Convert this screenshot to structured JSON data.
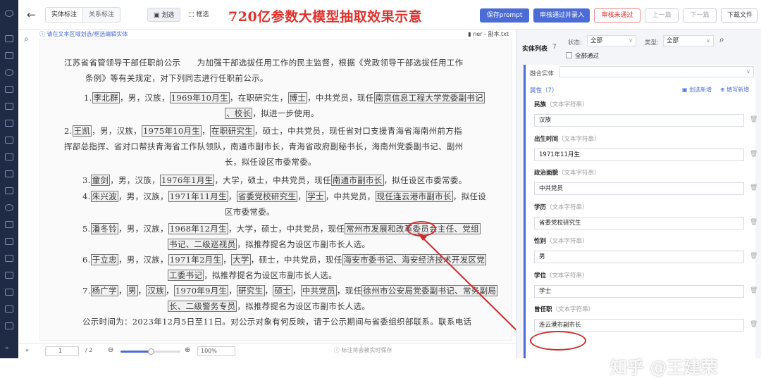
{
  "topbar": {
    "seg_entity": "实体标注",
    "seg_relation": "关系标注",
    "tool_mark": "划选",
    "tool_box": "框选",
    "headline": "720亿参数大模型抽取效果示意",
    "save_prompt": "保存prompt",
    "approve": "审核通过并录入",
    "reject": "审核未通过",
    "prev": "上一篇",
    "next": "下一篇",
    "download": "下载文件"
  },
  "doc": {
    "hint": "请在文本区域划选/框选编辑实体",
    "filename": "ner - 副本.txt",
    "lines": [
      [
        "江苏省省管领导干部任职前公示　　为加强干部选拔任用工作的民主监督，根据《党政领导干部选拔任用工作"
      ],
      [
        "条例》等有关规定，对下列同志进行任职前公示。"
      ],
      [
        "1.",
        {
          "b": "李北群"
        },
        "，男，汉族，",
        {
          "b": "1969年10月生"
        },
        "，在职研究生，",
        {
          "b": "博士"
        },
        "，中共党员，现任",
        {
          "b": "南京信息工程大学党委副书记"
        }
      ],
      [
        {
          "b": "、校长"
        },
        "，拟进一步使用。"
      ],
      [
        "2.",
        {
          "b": "王凯"
        },
        "，男，汉族，",
        {
          "b": "1975年10月生"
        },
        "，",
        {
          "b": "在职研究生"
        },
        "，硕士，中共党员，现任省对口支援青海省海南州前方指"
      ],
      [
        "挥部总指挥、省对口帮扶青海省工作队领队，南通市副市长，青海省政府副秘书长，海南州党委副书记、副州"
      ],
      [
        "长，拟任设区市委常委。"
      ],
      [
        "3.",
        {
          "b": "童剑"
        },
        "，男，汉族，",
        {
          "b": "1976年1月生"
        },
        "，大学，硕士，中共党员，现任",
        {
          "b": "南通市副市长"
        },
        "，拟任设区市委常委。"
      ],
      [
        "4.",
        {
          "b": "朱兴波"
        },
        "，男，汉族，",
        {
          "b": "1971年11月生"
        },
        "，",
        {
          "b": "省委党校研究生"
        },
        "，",
        {
          "b": "学士"
        },
        "，中共党员，",
        {
          "b": "现任连云港市副市长"
        },
        "，拟任设"
      ],
      [
        "区市委常委。"
      ],
      [
        "5.",
        {
          "b": "潘冬铃"
        },
        "，男，汉族，",
        {
          "b": "1968年12月生"
        },
        "，大学，硕士，中共党员，现任",
        {
          "b": "常州市发展和改革委员会主任、党组"
        }
      ],
      [
        {
          "b": "书记、二级巡视员"
        },
        "，拟推荐提名为设区市副市长人选。"
      ],
      [
        "6.",
        {
          "b": "于立忠"
        },
        "，男，汉族，",
        {
          "b": "1971年2月生"
        },
        "，",
        {
          "b": "大学"
        },
        "，硕士，中共党员，现任",
        {
          "b": "海安市委书记、海安经济技术开发区党"
        }
      ],
      [
        {
          "b": "工委书记"
        },
        "，拟推荐提名为设区市副市长人选。"
      ],
      [
        "7.",
        {
          "b": "杨广学"
        },
        "，",
        {
          "b": "男"
        },
        "，",
        {
          "b": "汉族"
        },
        "，",
        {
          "b": "1970年9月生"
        },
        "，",
        {
          "b": "研究生"
        },
        "，",
        {
          "b": "硕士"
        },
        "，",
        {
          "b": "中共党员"
        },
        "，现任",
        {
          "b": "徐州市公安局党委副书记、常务副局"
        }
      ],
      [
        {
          "b": "长、二级警务专员"
        },
        "，拟推荐提名为设区市副市长人选。"
      ],
      [
        "公示时间为：2023年12月5日至11日。对公示对象有何反映，请于公示期间与省委组织部联系。联系电话"
      ]
    ]
  },
  "pager": {
    "page": "1",
    "total": "/ 2",
    "zoom": "100%",
    "zoom_level": 0.5,
    "save_hint": "标注将会被实时保存"
  },
  "panel": {
    "title": "实体列表",
    "count": "7",
    "status_label": "状态:",
    "status_value": "全部",
    "type_label": "类型:",
    "type_value": "全部",
    "all_pass": "全部通过",
    "merge_label": "融合实体",
    "attr_label": "属性（7）",
    "add_mark": "划选新增",
    "add_fill": "填写新增",
    "type_text": "（文本字符串）",
    "fields": [
      {
        "name": "民族",
        "value": "汉族"
      },
      {
        "name": "出生时间",
        "value": "1971年11月生"
      },
      {
        "name": "政治面貌",
        "value": "中共党员"
      },
      {
        "name": "学历",
        "value": "省委党校研究生"
      },
      {
        "name": "性别",
        "value": "男"
      },
      {
        "name": "学位",
        "value": "学士"
      },
      {
        "name": "曾任职",
        "value": "连云港市副市长"
      }
    ]
  },
  "watermark": "知乎 @王建荣",
  "colors": {
    "accent": "#4b6bd6",
    "highlight": "#d42a2a",
    "headline": "#e0322d"
  }
}
